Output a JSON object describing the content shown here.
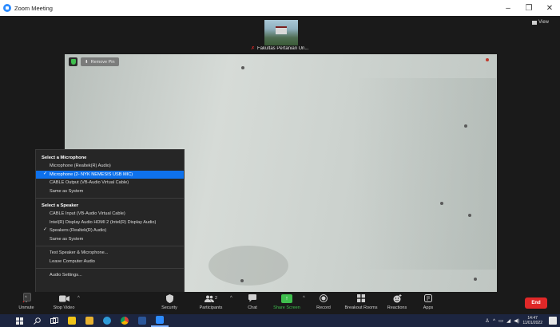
{
  "window": {
    "title": "Zoom Meeting",
    "controls": [
      "–",
      "❐",
      "✕"
    ]
  },
  "meeting": {
    "view_label": "View",
    "participant_thumb": {
      "name": "Fakultas Pertanian Un..."
    },
    "remove_pin_label": "Remove Pin"
  },
  "audio_menu": {
    "mic_header": "Select a Microphone",
    "microphones": [
      {
        "label": "Microphone (Realtek(R) Audio)",
        "selected": false
      },
      {
        "label": "Microphone (2- NYK NEMESIS USB MIC)",
        "selected": true
      },
      {
        "label": "CABLE Output (VB-Audio Virtual Cable)",
        "selected": false
      },
      {
        "label": "Same as System",
        "selected": false
      }
    ],
    "speaker_header": "Select a Speaker",
    "speakers": [
      {
        "label": "CABLE Input (VB-Audio Virtual Cable)",
        "selected": false
      },
      {
        "label": "Intel(R) Display Audio HDMI 2 (Intel(R) Display Audio)",
        "selected": false
      },
      {
        "label": "Speakers (Realtek(R) Audio)",
        "selected": true
      },
      {
        "label": "Same as System",
        "selected": false
      }
    ],
    "test_label": "Test Speaker & Microphone...",
    "leave_label": "Leave Computer Audio",
    "settings_label": "Audio Settings..."
  },
  "toolbar": {
    "unmute": "Unmute",
    "stop_video": "Stop Video",
    "security": "Security",
    "participants": "Participants",
    "participants_count": "2",
    "chat": "Chat",
    "share_screen": "Share Screen",
    "record": "Record",
    "breakout_rooms": "Breakout Rooms",
    "reactions": "Reactions",
    "apps": "Apps",
    "end": "End"
  },
  "taskbar": {
    "time": "14:47",
    "date": "11/01/2022"
  },
  "colors": {
    "accent_blue": "#0e71eb",
    "share_green": "#3fbf4e",
    "end_red": "#e02828"
  }
}
